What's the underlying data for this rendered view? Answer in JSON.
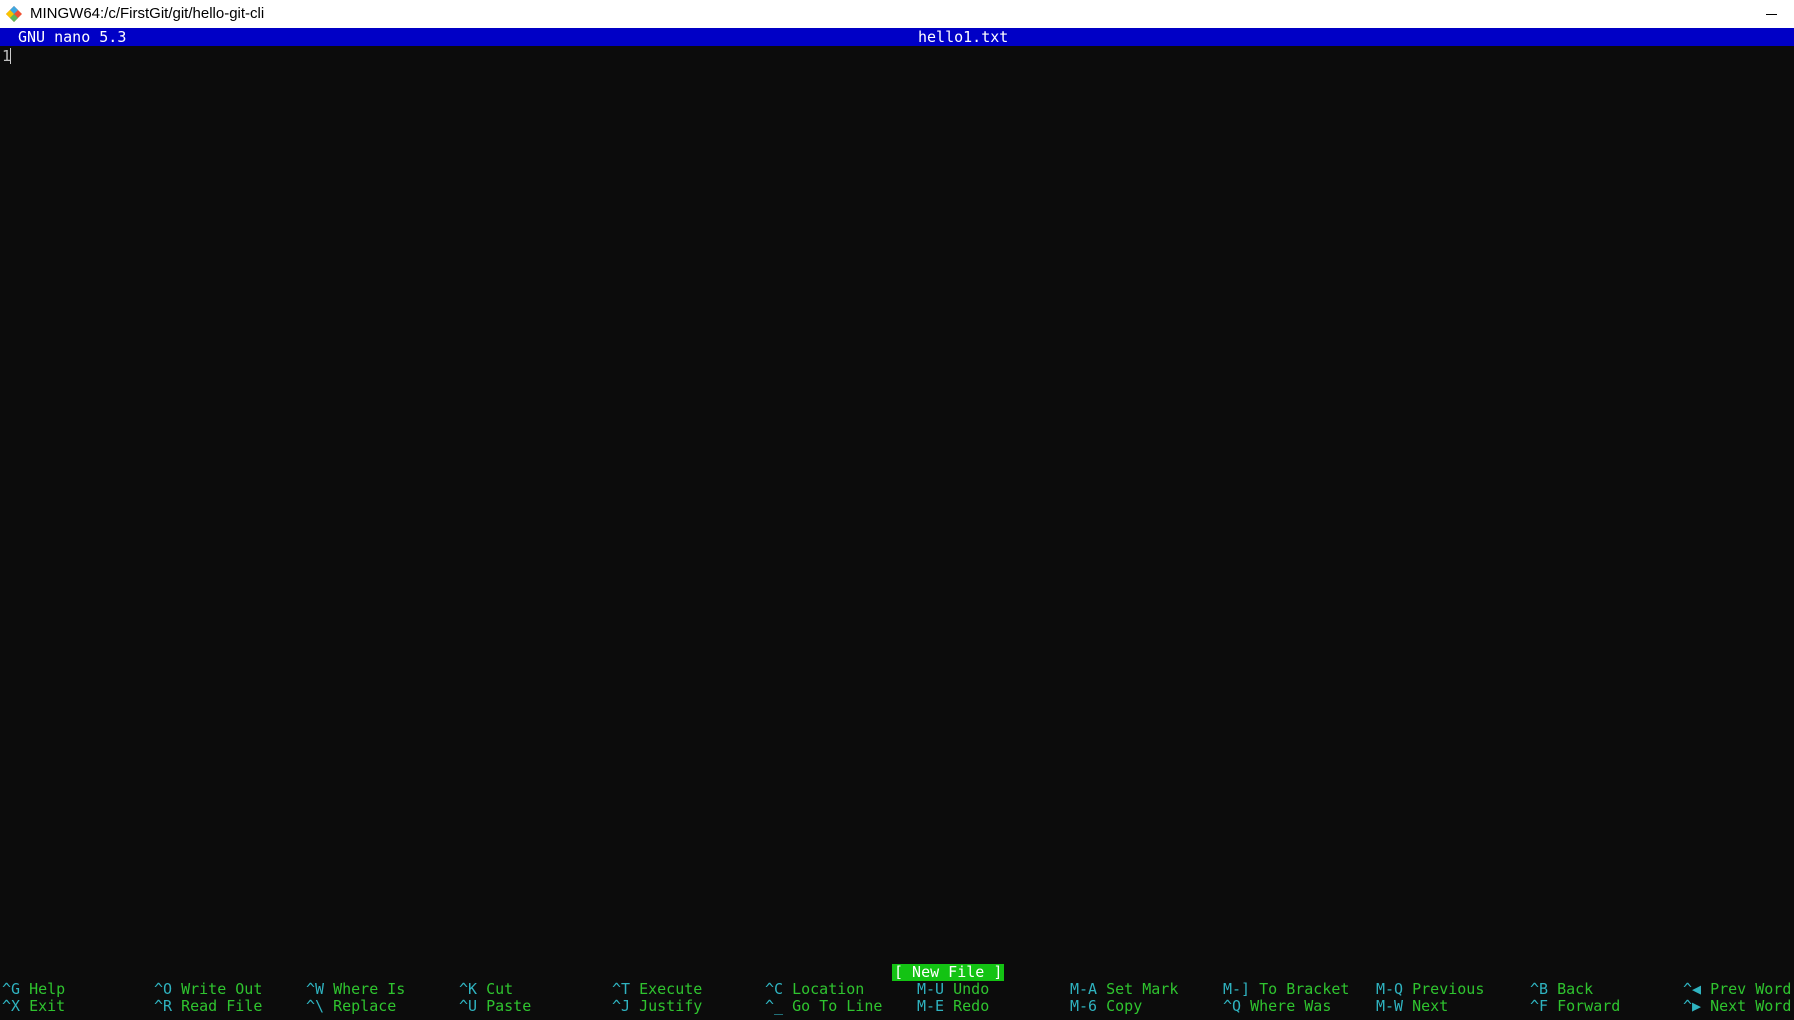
{
  "window": {
    "title": "MINGW64:/c/FirstGit/git/hello-git-cli",
    "icon": "git-bash-icon"
  },
  "nano": {
    "version": "GNU nano 5.3",
    "filename": "hello1.txt",
    "content": "1",
    "status_message": "[ New File ]"
  },
  "colors": {
    "header_bg": "#0000c6",
    "status_bg": "#13c313",
    "key_color": "#2fb3c0",
    "label_color": "#2fc42f",
    "terminal_bg": "#0c0c0c"
  },
  "shortcuts": {
    "row1": [
      {
        "key": "^G",
        "label": "Help"
      },
      {
        "key": "^O",
        "label": "Write Out"
      },
      {
        "key": "^W",
        "label": "Where Is"
      },
      {
        "key": "^K",
        "label": "Cut"
      },
      {
        "key": "^T",
        "label": "Execute"
      },
      {
        "key": "^C",
        "label": "Location"
      },
      {
        "key": "M-U",
        "label": "Undo"
      },
      {
        "key": "M-A",
        "label": "Set Mark"
      },
      {
        "key": "M-]",
        "label": "To Bracket"
      },
      {
        "key": "M-Q",
        "label": "Previous"
      },
      {
        "key": "^B",
        "label": "Back"
      },
      {
        "key": "^◀",
        "label": "Prev Word"
      }
    ],
    "row2": [
      {
        "key": "^X",
        "label": "Exit"
      },
      {
        "key": "^R",
        "label": "Read File"
      },
      {
        "key": "^\\",
        "label": "Replace"
      },
      {
        "key": "^U",
        "label": "Paste"
      },
      {
        "key": "^J",
        "label": "Justify"
      },
      {
        "key": "^_",
        "label": "Go To Line"
      },
      {
        "key": "M-E",
        "label": "Redo"
      },
      {
        "key": "M-6",
        "label": "Copy"
      },
      {
        "key": "^Q",
        "label": "Where Was"
      },
      {
        "key": "M-W",
        "label": "Next"
      },
      {
        "key": "^F",
        "label": "Forward"
      },
      {
        "key": "^▶",
        "label": "Next Word"
      }
    ]
  }
}
